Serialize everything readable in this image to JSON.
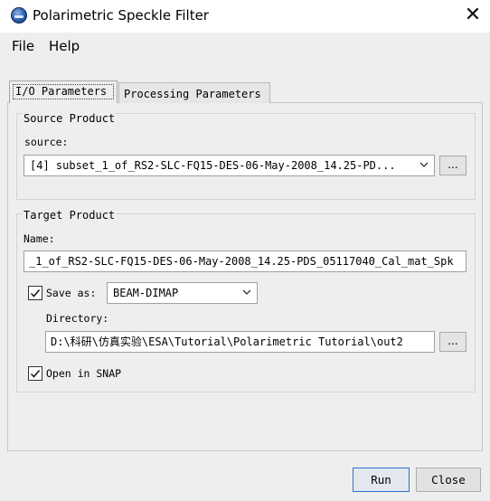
{
  "window": {
    "title": "Polarimetric Speckle Filter",
    "close_glyph": "✕"
  },
  "menu": {
    "file": "File",
    "help": "Help"
  },
  "tabs": {
    "io": "I/O Parameters",
    "processing": "Processing Parameters"
  },
  "source": {
    "group_title": "Source Product",
    "label": "source:",
    "selected": "[4] subset_1_of_RS2-SLC-FQ15-DES-06-May-2008_14.25-PD...",
    "browse": "..."
  },
  "target": {
    "group_title": "Target Product",
    "name_label": "Name:",
    "name_value": "_1_of_RS2-SLC-FQ15-DES-06-May-2008_14.25-PDS_05117040_Cal_mat_Spk",
    "save_as_label": "Save as:",
    "save_as_checked": true,
    "format": "BEAM-DIMAP",
    "directory_label": "Directory:",
    "directory_value": "D:\\科研\\仿真实验\\ESA\\Tutorial\\Polarimetric Tutorial\\out2",
    "browse": "...",
    "open_in_snap_label": "Open in SNAP",
    "open_in_snap_checked": true
  },
  "buttons": {
    "run": "Run",
    "close": "Close"
  },
  "icons": {
    "app": "snap-logo-icon",
    "close": "close-icon",
    "chevron": "chevron-down-icon",
    "check": "checkmark-icon"
  }
}
